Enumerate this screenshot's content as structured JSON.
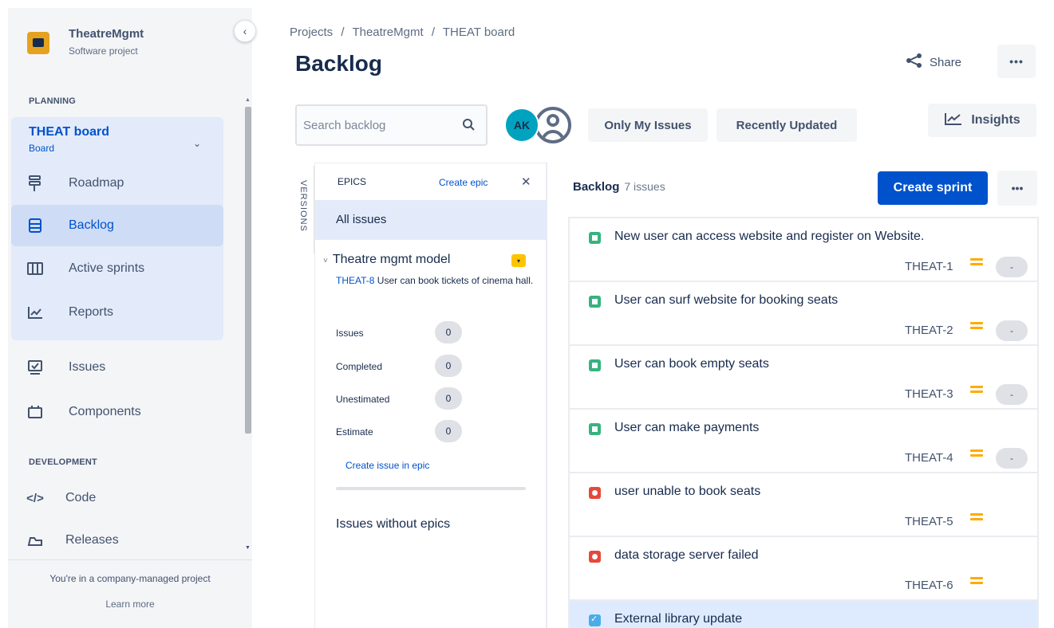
{
  "project": {
    "name": "TheatreMgmt",
    "type": "Software project",
    "collapse_glyph": "‹"
  },
  "sidebar": {
    "planning_label": "PLANNING",
    "board": {
      "title": "THEAT board",
      "subtitle": "Board",
      "chevron": "⌄"
    },
    "items": [
      {
        "label": "Roadmap",
        "icon": "roadmap-icon"
      },
      {
        "label": "Backlog",
        "icon": "backlog-icon",
        "active": true
      },
      {
        "label": "Active sprints",
        "icon": "active-sprints-icon"
      },
      {
        "label": "Reports",
        "icon": "reports-icon"
      },
      {
        "label": "Issues",
        "icon": "issues-icon"
      },
      {
        "label": "Components",
        "icon": "components-icon"
      }
    ],
    "development_label": "DEVELOPMENT",
    "dev_items": [
      {
        "label": "Code",
        "icon": "code-icon"
      },
      {
        "label": "Releases",
        "icon": "releases-icon"
      }
    ],
    "footer": {
      "text": "You're in a company-managed project",
      "link": "Learn more"
    }
  },
  "header": {
    "breadcrumb": [
      "Projects",
      "TheatreMgmt",
      "THEAT board"
    ],
    "breadcrumb_sep": "/",
    "title": "Backlog",
    "share_label": "Share",
    "more_glyph": "•••"
  },
  "toolbar": {
    "search_placeholder": "Search backlog",
    "avatar_initials": "AK",
    "filters": [
      "Only My Issues",
      "Recently Updated"
    ],
    "insights_label": "Insights"
  },
  "versions_label": "VERSIONS",
  "epics": {
    "header": "EPICS",
    "create_label": "Create epic",
    "close_glyph": "✕",
    "all_issues": "All issues",
    "epic": {
      "name": "Theatre mgmt model",
      "twisty": "˅",
      "key": "THEAT-8",
      "summary": "User can book tickets of cinema hall.",
      "stats": [
        {
          "label": "Issues",
          "value": "0"
        },
        {
          "label": "Completed",
          "value": "0"
        },
        {
          "label": "Unestimated",
          "value": "0"
        },
        {
          "label": "Estimate",
          "value": "0"
        }
      ],
      "create_issue_label": "Create issue in epic"
    },
    "without_epics": "Issues without epics"
  },
  "backlog": {
    "title": "Backlog",
    "count": "7 issues",
    "create_sprint_label": "Create sprint",
    "more_glyph": "•••",
    "issues": [
      {
        "type": "story",
        "summary": "New user can access website and register on Website.",
        "key": "THEAT-1",
        "estimate": "-"
      },
      {
        "type": "story",
        "summary": "User can surf website for booking seats",
        "key": "THEAT-2",
        "estimate": "-"
      },
      {
        "type": "story",
        "summary": "User can book empty seats",
        "key": "THEAT-3",
        "estimate": "-"
      },
      {
        "type": "story",
        "summary": "User can make payments",
        "key": "THEAT-4",
        "estimate": "-"
      },
      {
        "type": "bug",
        "summary": "user unable to book seats",
        "key": "THEAT-5",
        "estimate": ""
      },
      {
        "type": "bug",
        "summary": "data storage server failed",
        "key": "THEAT-6",
        "estimate": ""
      },
      {
        "type": "task",
        "summary": "External library update",
        "key": "",
        "estimate": ""
      }
    ]
  },
  "colors": {
    "primary": "#0052cc",
    "priority_medium": "#ffab00",
    "story": "#36b37e",
    "bug": "#e5493a",
    "task": "#4bade8",
    "avatar": "#00a3bf"
  }
}
